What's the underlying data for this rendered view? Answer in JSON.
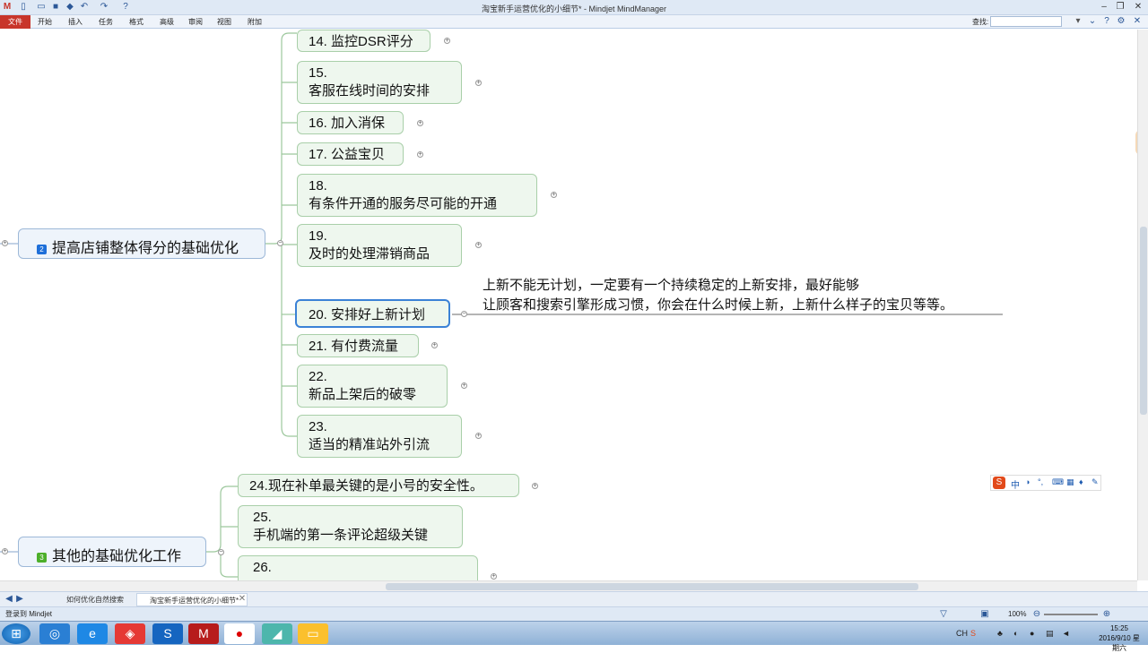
{
  "window": {
    "title": "淘宝新手运营优化的小细节* - Mindjet MindManager"
  },
  "ribbon": {
    "file_tab": "文件",
    "tabs": [
      "开始",
      "插入",
      "任务",
      "格式",
      "高级",
      "审阅",
      "视图",
      "附加"
    ],
    "find_label": "查找:"
  },
  "map": {
    "topic2": {
      "number": "2",
      "label": "提高店铺整体得分的基础优化"
    },
    "topic3": {
      "number": "3",
      "label": "其他的基础优化工作"
    },
    "subtopics": [
      {
        "line1": "14. 监控DSR评分",
        "line2": ""
      },
      {
        "line1": "15.",
        "line2": "客服在线时间的安排"
      },
      {
        "line1": "16. 加入消保",
        "line2": ""
      },
      {
        "line1": "17. 公益宝贝",
        "line2": ""
      },
      {
        "line1": "18.",
        "line2": "有条件开通的服务尽可能的开通"
      },
      {
        "line1": "19.",
        "line2": "及时的处理滞销商品"
      },
      {
        "line1": "20. 安排好上新计划",
        "line2": ""
      },
      {
        "line1": "21. 有付费流量",
        "line2": ""
      },
      {
        "line1": "22.",
        "line2": "新品上架后的破零"
      },
      {
        "line1": "23.",
        "line2": "适当的精准站外引流"
      }
    ],
    "subtopics3": [
      {
        "line1": "24.现在补单最关键的是小号的安全性。",
        "line2": ""
      },
      {
        "line1": "25.",
        "line2": "手机端的第一条评论超级关键"
      },
      {
        "line1": "26.",
        "line2": ""
      }
    ],
    "note": {
      "line1": "上新不能无计划，一定要有一个持续稳定的上新安排，最好能够",
      "line2": "让顾客和搜索引擎形成习惯，你会在什么时候上新，上新什么样子的宝贝等等。"
    }
  },
  "doc_tabs": [
    "如何优化自然搜索",
    "淘宝新手运营优化的小细节*"
  ],
  "status": {
    "left_text": "登录到 Mindjet",
    "zoom": "100%"
  },
  "taskbar": {
    "time": "15:25",
    "date": "2016/9/10 星期六",
    "lang": "CH"
  },
  "colors": {
    "topic_num_blue": "#1e6fd9",
    "topic_num_green": "#4caf2a",
    "selection": "#3b82d6",
    "file_tab": "#c8352a"
  }
}
